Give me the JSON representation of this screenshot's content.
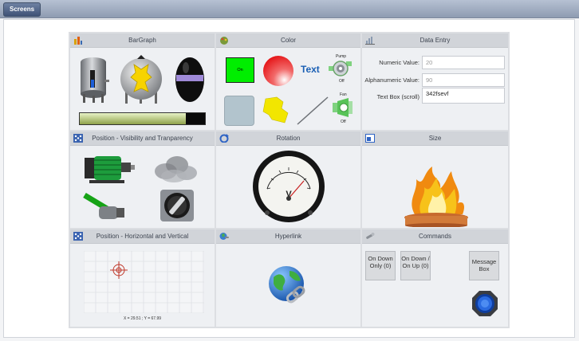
{
  "topbar": {
    "screens_label": "Screens"
  },
  "panels": {
    "bargraph": {
      "title": "BarGraph",
      "bar_level": 0.85
    },
    "color": {
      "title": "Color",
      "on_label": "On",
      "text_label": "Text",
      "pump_label": "Pump",
      "pump_state": "Off",
      "fan_label": "Fan",
      "fan_state": "Off"
    },
    "data_entry": {
      "title": "Data Entry",
      "fields": [
        {
          "label": "Numeric Value:",
          "value": "20"
        },
        {
          "label": "Alphanumeric Value:",
          "value": "90"
        },
        {
          "label": "Text Box (scroll)",
          "value": "342fsevf"
        }
      ]
    },
    "visibility": {
      "title": "Position - Visibility and Tranparency"
    },
    "rotation": {
      "title": "Rotation",
      "gauge_letter": "V"
    },
    "size": {
      "title": "Size"
    },
    "horiz_vert": {
      "title": "Position - Horizontal and Vertical",
      "readout": "X = 29.51 ; Y = 67.99"
    },
    "hyperlink": {
      "title": "Hyperlink"
    },
    "commands": {
      "title": "Commands",
      "btn_down_only": "On Down Only (0)",
      "btn_down_up": "On Down / On Up (0)",
      "btn_message": "Message Box"
    }
  },
  "colors": {
    "accent_green": "#00ee00",
    "text_blue": "#1a5fb4",
    "red": "#e02020",
    "yellow": "#f2e600"
  }
}
